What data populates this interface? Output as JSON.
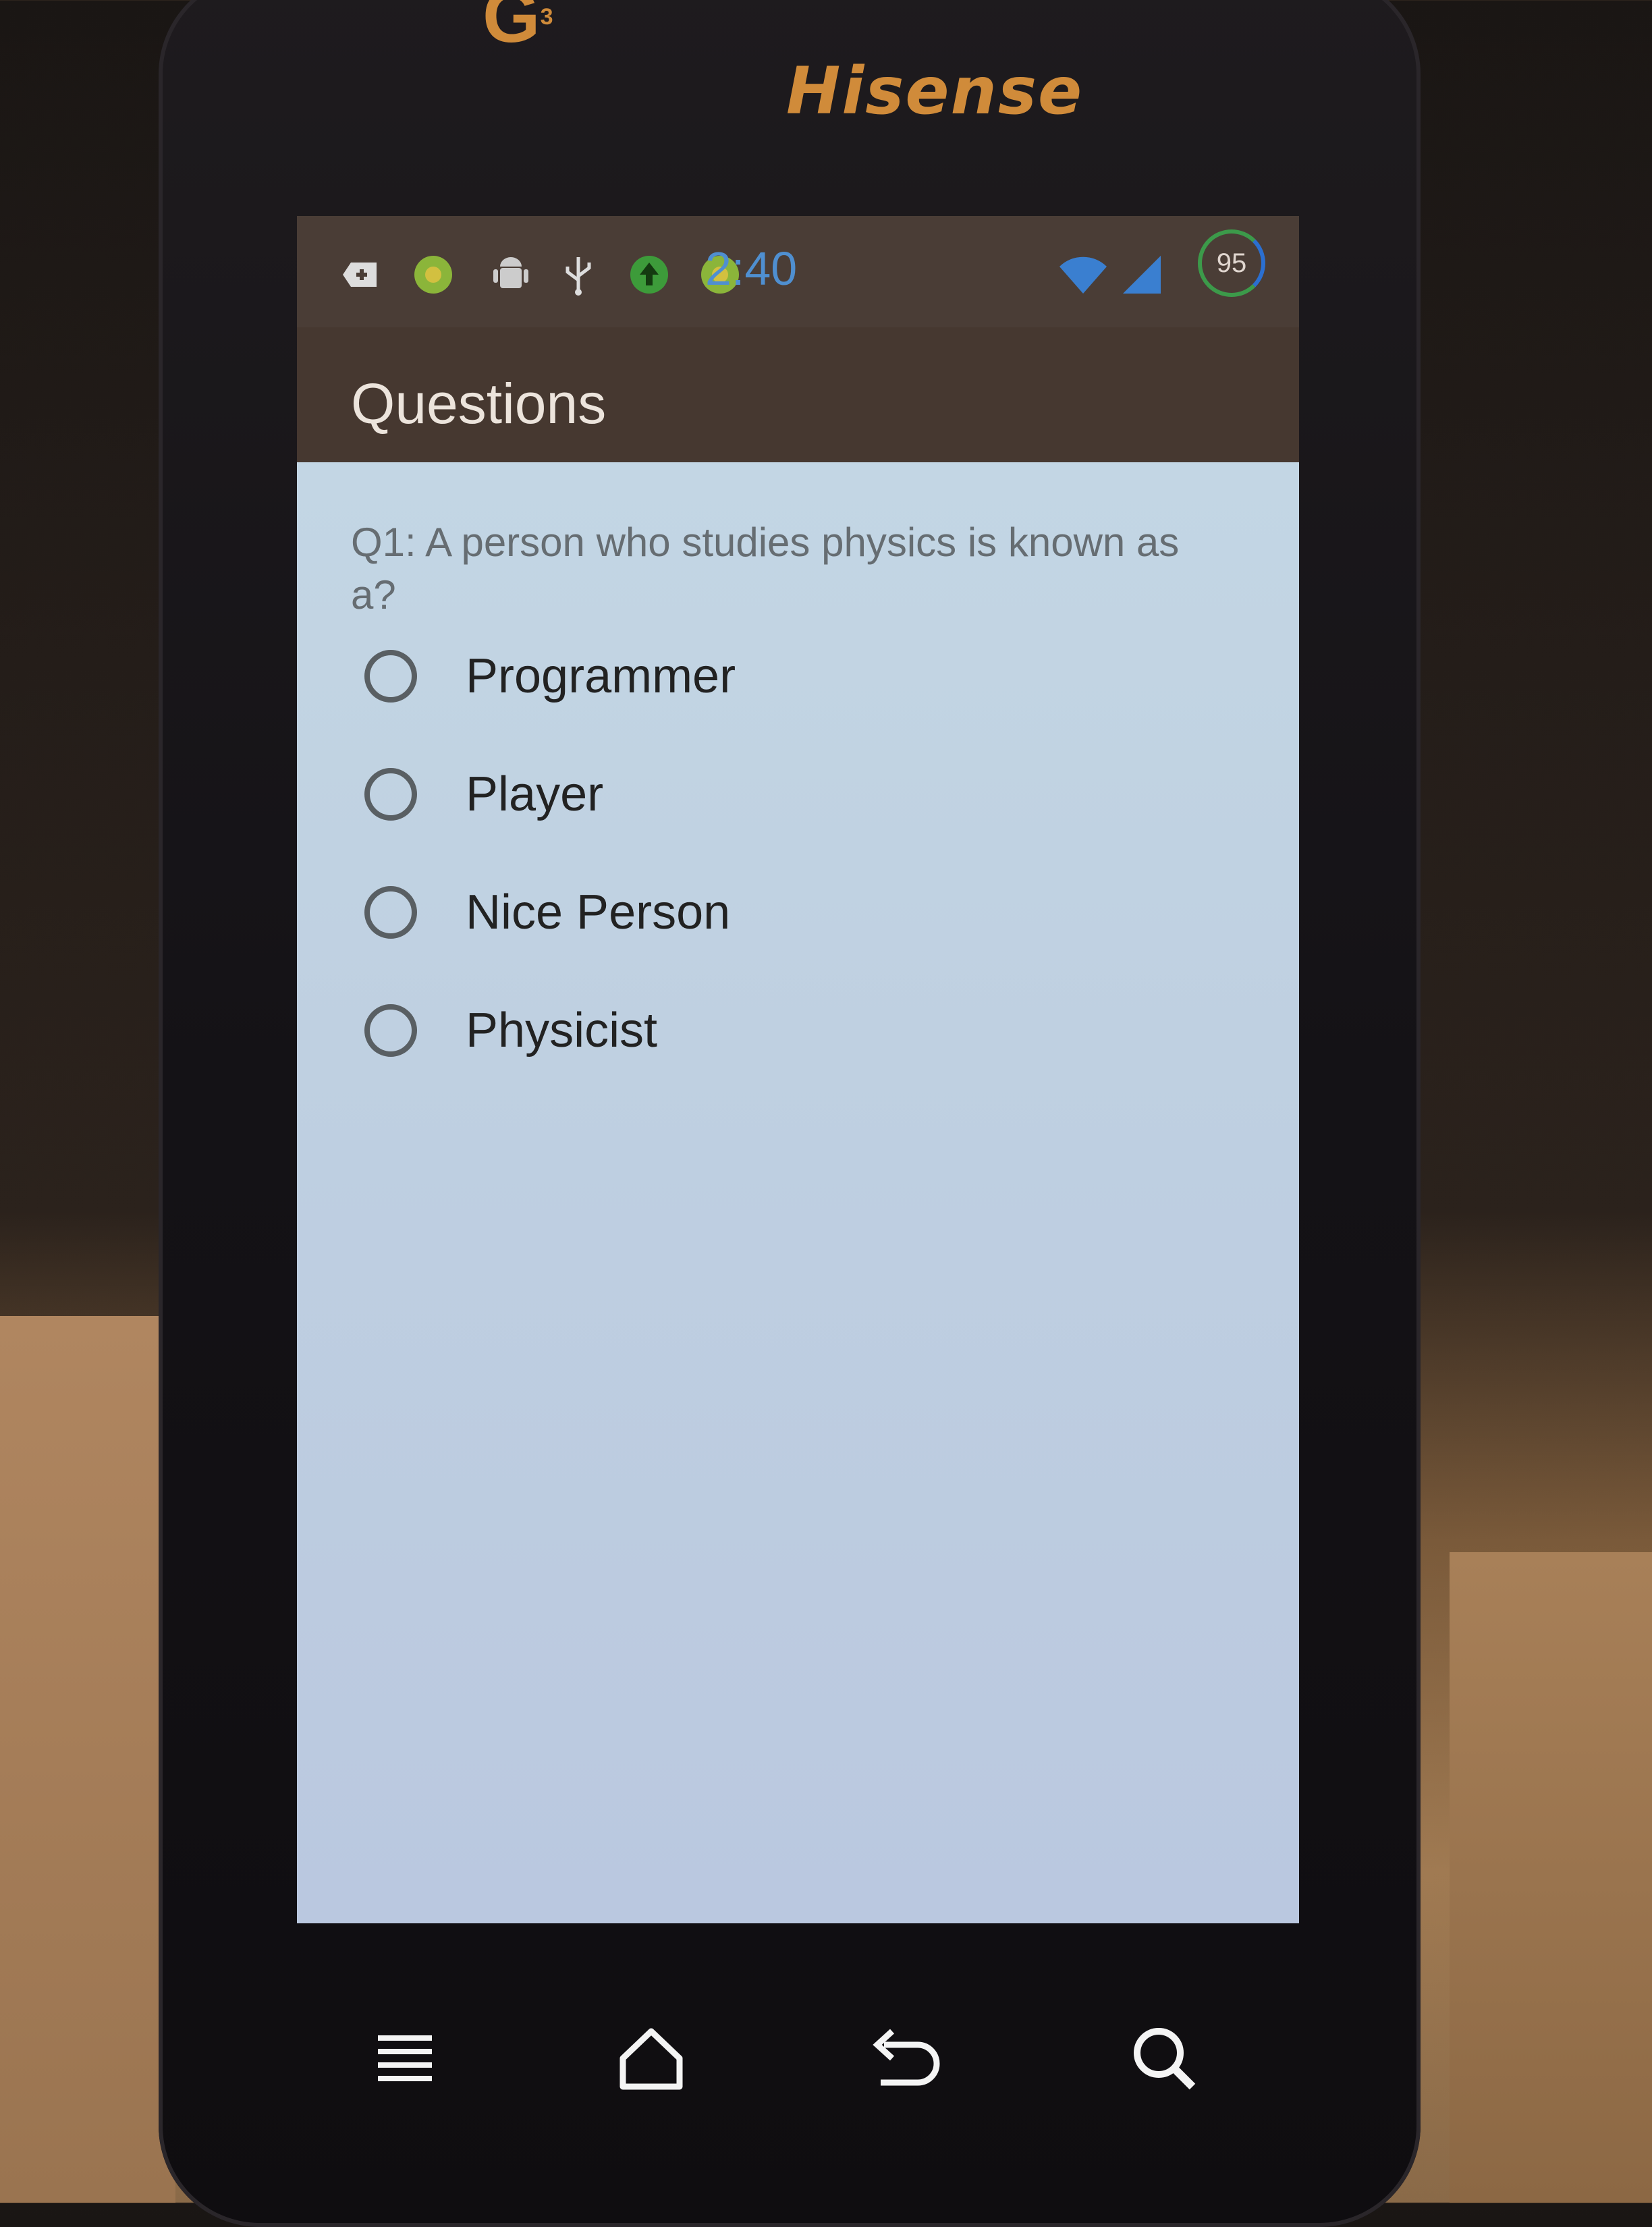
{
  "device": {
    "brand": "Hisense",
    "logo": "G",
    "logo_sup": "3"
  },
  "status_bar": {
    "time": "2:40",
    "battery": "95",
    "icons": [
      "add-icon",
      "green-app-icon",
      "android-debug-icon",
      "usb-icon",
      "upload-icon",
      "green-app-icon",
      "wifi-icon",
      "signal-icon"
    ]
  },
  "action_bar": {
    "title": "Questions"
  },
  "question": {
    "text": "Q1: A person who studies physics is known as a?",
    "options": [
      "Programmer",
      "Player",
      "Nice Person",
      "Physicist"
    ]
  },
  "nav_bar": {
    "buttons": [
      "menu-icon",
      "home-icon",
      "back-icon",
      "search-icon"
    ]
  },
  "colors": {
    "status_bar": "#4a3d36",
    "action_bar": "#463830",
    "content_bg": "#c3d6e4",
    "clock": "#4f8fd0",
    "brand": "#d08b3a"
  }
}
